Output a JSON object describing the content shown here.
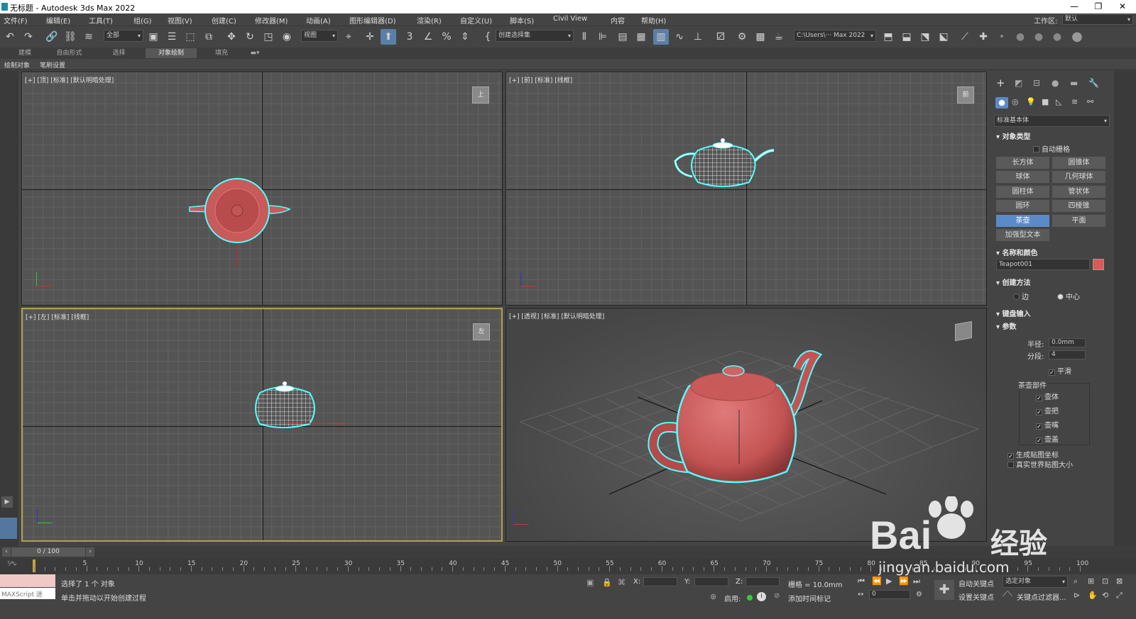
{
  "window": {
    "title": "无标题 - Autodesk 3ds Max 2022"
  },
  "menu": [
    "文件(F)",
    "编辑(E)",
    "工具(T)",
    "组(G)",
    "视图(V)",
    "创建(C)",
    "修改器(M)",
    "动画(A)",
    "图形编辑器(D)",
    "渲染(R)",
    "自定义(U)",
    "脚本(S)",
    "Civil View",
    "内容",
    "帮助(H)"
  ],
  "workspace": {
    "label": "工作区:",
    "value": "默认"
  },
  "toolbar": {
    "selection_filter": "全部",
    "ref_coord": "视图",
    "named_selection": "创建选择集",
    "project_path": "C:\\Users\\··· Max 2022"
  },
  "ribbon": {
    "tabs": [
      "建模",
      "自由形式",
      "选择",
      "对象绘制",
      "填充"
    ],
    "selected": "对象绘制"
  },
  "subribbon": {
    "items": [
      "绘制对象",
      "笔刷设置"
    ]
  },
  "viewports": {
    "top": "[+] [顶] [标准] [默认明暗处理]",
    "front": "[+] [前] [标准] [线框]",
    "left": "[+] [左] [标准] [线框]",
    "persp": "[+] [透视] [标准] [默认明暗处理]",
    "top_cube": "上",
    "front_cube": "前",
    "left_cube": "左"
  },
  "command_panel": {
    "dropdown": "标准基本体",
    "object_type": {
      "title": "对象类型",
      "autogrid": "自动栅格",
      "buttons": [
        "长方体",
        "圆锥体",
        "球体",
        "几何球体",
        "圆柱体",
        "管状体",
        "圆环",
        "四棱锥",
        "茶壶",
        "平面",
        "加强型文本"
      ],
      "selected": "茶壶"
    },
    "name_color": {
      "title": "名称和颜色",
      "name": "Teapot001",
      "color": "#e05757"
    },
    "creation_method": {
      "title": "创建方法",
      "options": [
        "边",
        "中心"
      ],
      "selected": "中心"
    },
    "keyboard_entry": {
      "title": "键盘输入"
    },
    "parameters": {
      "title": "参数",
      "radius_label": "半径:",
      "radius": "0.0mm",
      "segments_label": "分段:",
      "segments": "4",
      "smooth": "平滑",
      "parts_title": "茶壶部件",
      "parts": [
        "壶体",
        "壶把",
        "壶嘴",
        "壶盖"
      ],
      "gen_map": "生成贴图坐标",
      "real_world": "真实世界贴图大小"
    }
  },
  "timeline": {
    "frame": "0 / 100",
    "ticks": [
      "5",
      "10",
      "15",
      "20",
      "25",
      "30",
      "35",
      "40",
      "45",
      "50",
      "55",
      "60",
      "65",
      "70",
      "75",
      "80",
      "85",
      "90",
      "95",
      "100"
    ]
  },
  "status": {
    "maxscript": "MAXScript 迷",
    "selected": "选择了 1 个 对象",
    "prompt": "单击并拖动以开始创建过程",
    "x_label": "X:",
    "y_label": "Y:",
    "z_label": "Z:",
    "grid": "栅格 = 10.0mm",
    "enable": "启用:",
    "add_time_tag": "添加时间标记",
    "auto_key": "自动关键点",
    "set_key": "设置关键点",
    "selected_obj": "选定对象",
    "key_filters": "关键点过滤器...",
    "frame_field": "0"
  },
  "watermark": {
    "brand": "Bai",
    "brand2": "经验",
    "url": "jingyan.baidu.com"
  }
}
